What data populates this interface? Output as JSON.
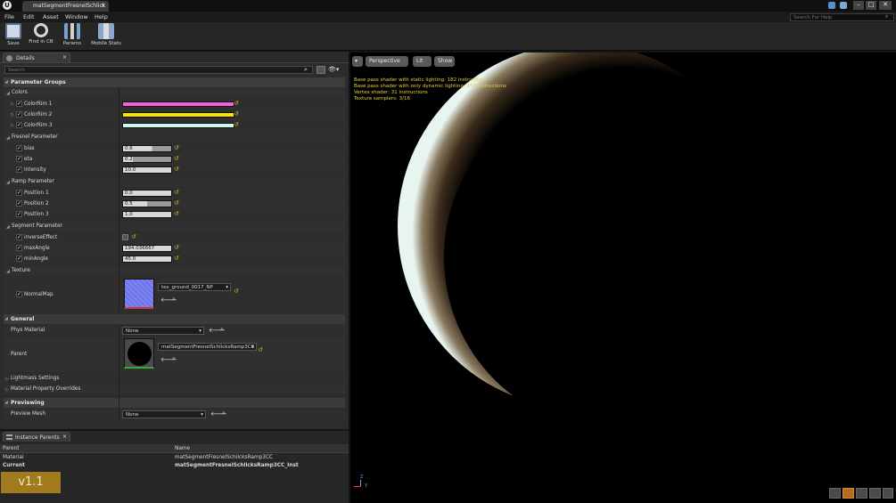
{
  "title_tab": "matSegmentFresnelSchlick",
  "search_help_placeholder": "Search For Help",
  "menu": [
    "File",
    "Edit",
    "Asset",
    "Window",
    "Help"
  ],
  "toolbar": [
    "Save",
    "Find in CB",
    "Params",
    "Mobile Stats"
  ],
  "details": {
    "tab": "Details",
    "search_placeholder": "Search",
    "parameter_groups": "Parameter Groups",
    "colors_group": "Colors",
    "colors": [
      {
        "label": "ColorRim 1",
        "color": "#f25fe0"
      },
      {
        "label": "ColorRim 2",
        "color": "#f4e800"
      },
      {
        "label": "ColorRim 3",
        "color": "#d2f6f4"
      }
    ],
    "fresnel_group": "Fresnel Parameter",
    "fresnel": [
      {
        "label": "bias",
        "value": "0.6",
        "fill": 0.6
      },
      {
        "label": "eta",
        "value": "0.2",
        "fill": 0.2
      },
      {
        "label": "Intensity",
        "value": "10.0",
        "fill": 0
      }
    ],
    "ramp_group": "Ramp Parameter",
    "ramp": [
      {
        "label": "Position 1",
        "value": "0.0",
        "fill": 0
      },
      {
        "label": "Position 2",
        "value": "0.5",
        "fill": 0.5
      },
      {
        "label": "Position 3",
        "value": "1.0",
        "fill": 0
      }
    ],
    "segment_group": "Segment Parameter",
    "inverse_label": "inverseEffect",
    "max_label": "maxAngle",
    "max_value": "194.036667",
    "min_label": "minAngle",
    "min_value": "45.0",
    "texture_group": "Texture",
    "normalmap_label": "NormalMap",
    "normalmap_asset": "tex_ground_0017_NP",
    "general": "General",
    "phys_label": "Phys Material",
    "phys_value": "None",
    "parent_label": "Parent",
    "parent_value": "matSegmentFresnelSchlicksRamp3CC",
    "lightmass": "Lightmass Settings",
    "overrides": "Material Property Overrides",
    "previewing": "Previewing",
    "preview_mesh_label": "Preview Mesh",
    "preview_mesh_value": "None"
  },
  "viewport": {
    "perspective": "Perspective",
    "lit": "Lit",
    "show": "Show",
    "stats": [
      "Base pass shader with static lighting: 182 instructions",
      "Base pass shader with only dynamic lighting: 157 instructions",
      "Vertex shader: 31 instructions",
      "Texture samplers: 3/16"
    ],
    "axis_z": "Z",
    "axis_y": "Y"
  },
  "instance_parents": {
    "tab": "Instance Parents",
    "columns": [
      "Parent",
      "Name"
    ],
    "rows": [
      {
        "parent": "Material",
        "name": "matSegmentFresnelSchlicksRamp3CC"
      },
      {
        "parent": "Current",
        "name": "matSegmentFresnelSchlicksRamp3CC_Inst"
      }
    ]
  },
  "version": "v1.1"
}
